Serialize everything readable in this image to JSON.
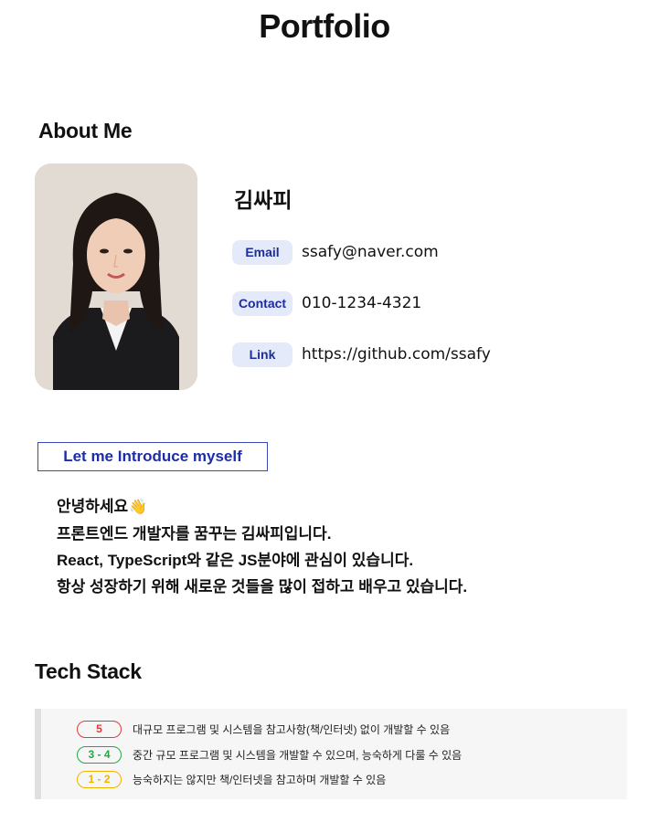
{
  "page": {
    "title": "Portfolio"
  },
  "about": {
    "section_title": "About Me",
    "name": "김싸피",
    "email": {
      "label": "Email",
      "value": "ssafy@naver.com"
    },
    "contact": {
      "label": "Contact",
      "value": "010-1234-4321"
    },
    "link": {
      "label": "Link",
      "value": "https://github.com/ssafy"
    },
    "photo_icon": "profile-photo"
  },
  "intro": {
    "box_label": "Let me Introduce myself",
    "lines": [
      "안녕하세요",
      "프론트엔드 개발자를 꿈꾸는 김싸피입니다.",
      "React, TypeScript와 같은 JS분야에 관심이 있습니다.",
      "항상 성장하기 위해 새로운 것들을 많이 접하고 배우고 있습니다."
    ],
    "wave_icon": "👋"
  },
  "tech": {
    "section_title": "Tech Stack",
    "levels": [
      {
        "badge": "5",
        "color": "#e53935",
        "text": "대규모 프로그램 및 시스템을 참고사항(책/인터넷) 없이 개발할 수 있음"
      },
      {
        "badge": "3 - 4",
        "color": "#1faa3f",
        "text": "중간 규모 프로그램 및 시스템을 개발할 수 있으며, 능숙하게 다룰 수 있음"
      },
      {
        "badge": "1 - 2",
        "color": "#f2b200",
        "text": "능숙하지는 않지만 책/인터넷을 참고하며 개발할 수 있음"
      }
    ]
  },
  "colors": {
    "badge_bg": "#e5eafb",
    "badge_text": "#1d2d9a",
    "intro_border": "#3b49b8",
    "panel_bg": "#f6f6f6"
  }
}
